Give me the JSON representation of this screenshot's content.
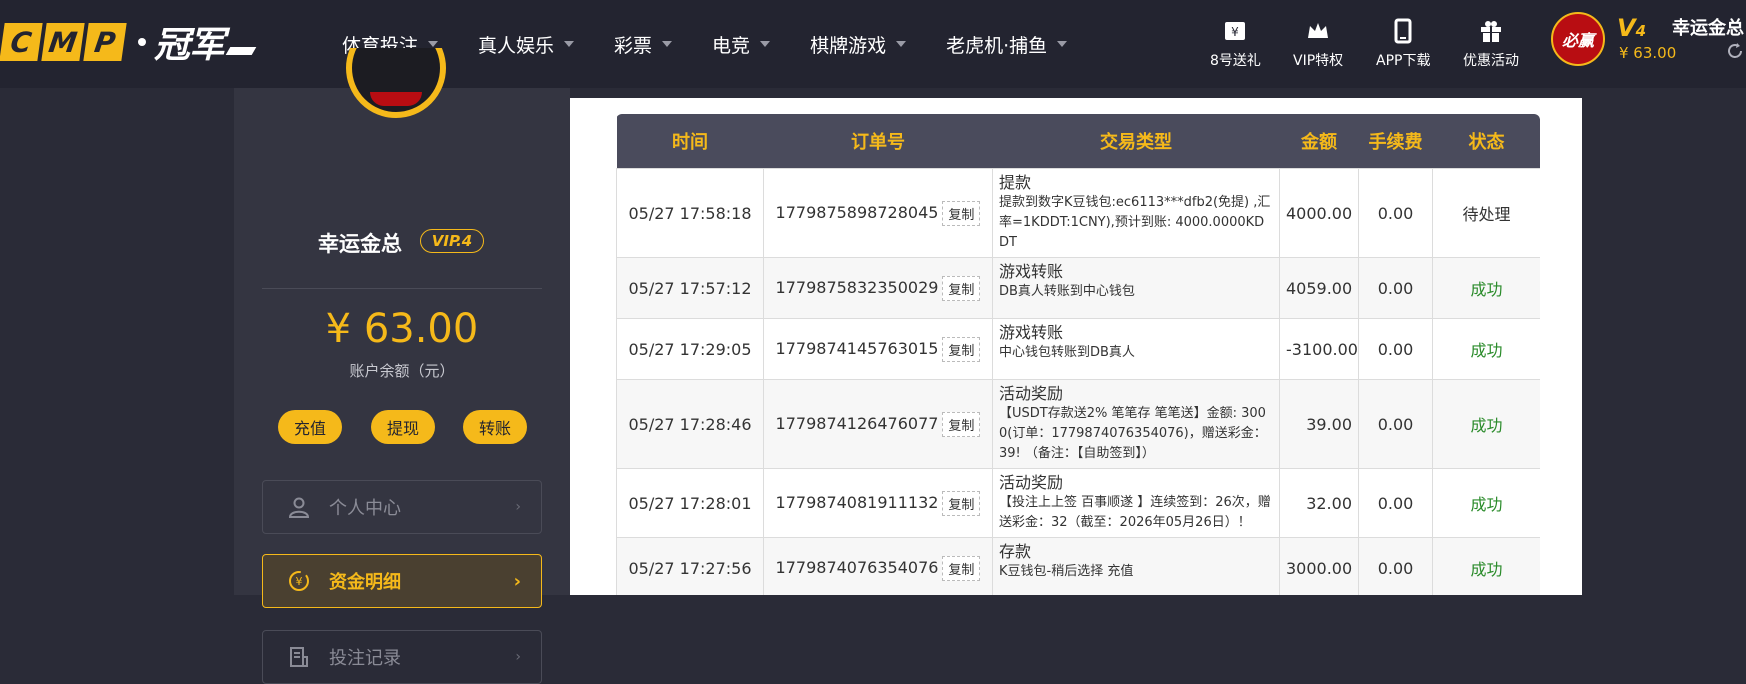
{
  "header": {
    "logo_letters": [
      "C",
      "M",
      "P"
    ],
    "logo_cn": "冠军",
    "nav": [
      {
        "label": "体育投注"
      },
      {
        "label": "真人娱乐"
      },
      {
        "label": "彩票"
      },
      {
        "label": "电竞"
      },
      {
        "label": "棋牌游戏"
      },
      {
        "label": "老虎机·捕鱼"
      }
    ],
    "quick_links": [
      {
        "label": "8号送礼",
        "icon": "gift-voucher-icon"
      },
      {
        "label": "VIP特权",
        "icon": "crown-icon"
      },
      {
        "label": "APP下载",
        "icon": "phone-icon"
      },
      {
        "label": "优惠活动",
        "icon": "gift-box-icon"
      }
    ],
    "avatar_text": "必赢",
    "vip_prefix": "V",
    "vip_level": "4",
    "balance": "¥ 63.00",
    "username": "幸运金总"
  },
  "sidebar": {
    "username": "幸运金总",
    "vip_badge": "VIP.4",
    "amount": "¥ 63.00",
    "amount_label": "账户余额（元）",
    "buttons": {
      "deposit": "充值",
      "withdraw": "提现",
      "transfer": "转账"
    },
    "menu": [
      {
        "label": "个人中心",
        "icon": "user-icon"
      },
      {
        "label": "资金明细",
        "icon": "funds-icon"
      },
      {
        "label": "投注记录",
        "icon": "records-icon"
      }
    ]
  },
  "table": {
    "headers": [
      "时间",
      "订单号",
      "交易类型",
      "金额",
      "手续费",
      "状态"
    ],
    "copy_label": "复制",
    "rows": [
      {
        "time": "05/27 17:58:18",
        "order": "1779875898728045",
        "type_title": "提款",
        "type_desc": "提款到数字K豆钱包:ec6113***dfb2(免提) ,汇率=1KDDT:1CNY),预计到账: 4000.0000KDDT",
        "amount": "4000.00",
        "fee": "0.00",
        "status": "待处理",
        "status_kind": "pending"
      },
      {
        "time": "05/27 17:57:12",
        "order": "1779875832350029",
        "type_title": "游戏转账",
        "type_desc": "DB真人转账到中心钱包",
        "amount": "4059.00",
        "fee": "0.00",
        "status": "成功",
        "status_kind": "ok"
      },
      {
        "time": "05/27 17:29:05",
        "order": "1779874145763015",
        "type_title": "游戏转账",
        "type_desc": "中心钱包转账到DB真人",
        "amount": "-3100.00",
        "fee": "0.00",
        "status": "成功",
        "status_kind": "ok"
      },
      {
        "time": "05/27 17:28:46",
        "order": "1779874126476077",
        "type_title": "活动奖励",
        "type_desc": "【USDT存款送2% 笔笔存 笔笔送】金额: 3000(订单：1779874076354076)，赠送彩金：39! （备注：【自助签到】）",
        "amount": "39.00",
        "fee": "0.00",
        "status": "成功",
        "status_kind": "ok"
      },
      {
        "time": "05/27 17:28:01",
        "order": "1779874081911132",
        "type_title": "活动奖励",
        "type_desc": "【投注上上签 百事顺遂 】连续签到：26次，赠送彩金：32（截至：2026年05月26日）！",
        "amount": "32.00",
        "fee": "0.00",
        "status": "成功",
        "status_kind": "ok"
      },
      {
        "time": "05/27 17:27:56",
        "order": "1779874076354076",
        "type_title": "存款",
        "type_desc": "K豆钱包-稍后选择 充值",
        "amount": "3000.00",
        "fee": "0.00",
        "status": "成功",
        "status_kind": "ok"
      }
    ]
  }
}
